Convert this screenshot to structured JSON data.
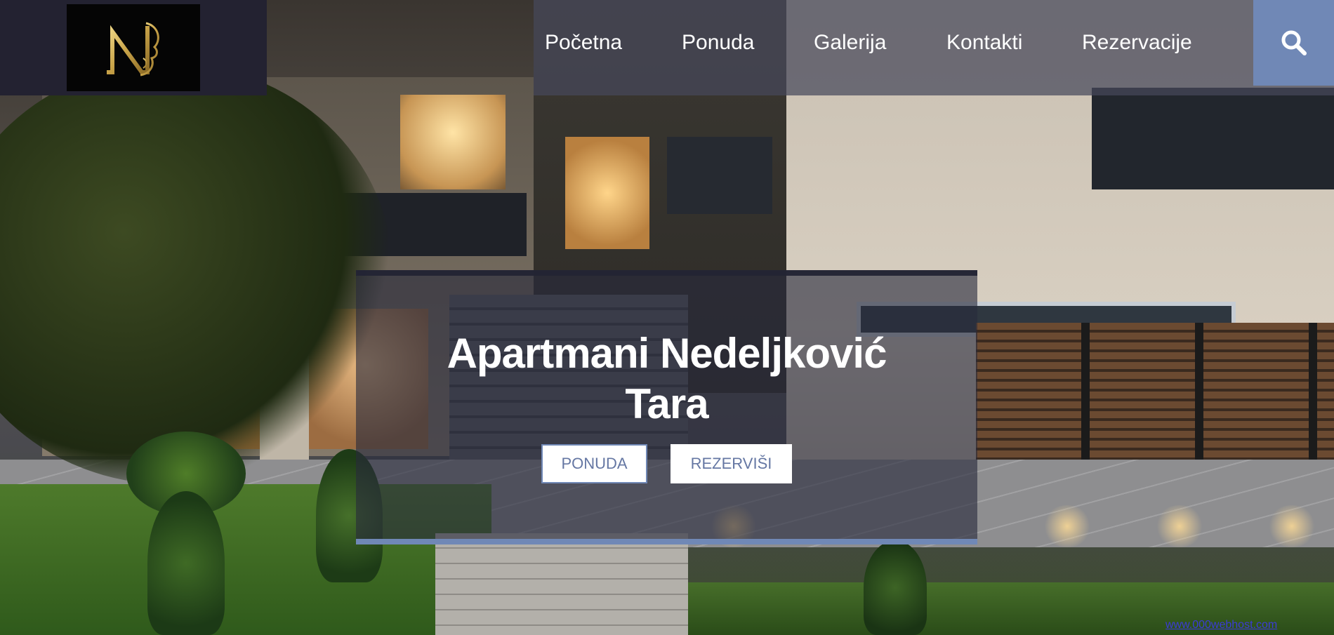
{
  "logo": {
    "letter": "N",
    "color": "#c9a449"
  },
  "nav": {
    "items": [
      "Početna",
      "Ponuda",
      "Galerija",
      "Kontakti",
      "Rezervacije"
    ],
    "accent": "#7088b6"
  },
  "search": {
    "icon": "search-icon"
  },
  "hero": {
    "title_line1": "Apartmani Nedeljković",
    "title_line2": "Tara",
    "btn_ponuda": "PONUDA",
    "btn_rezervisi": "REZERVIŠI"
  },
  "footer_link": "www.000webhost.com"
}
